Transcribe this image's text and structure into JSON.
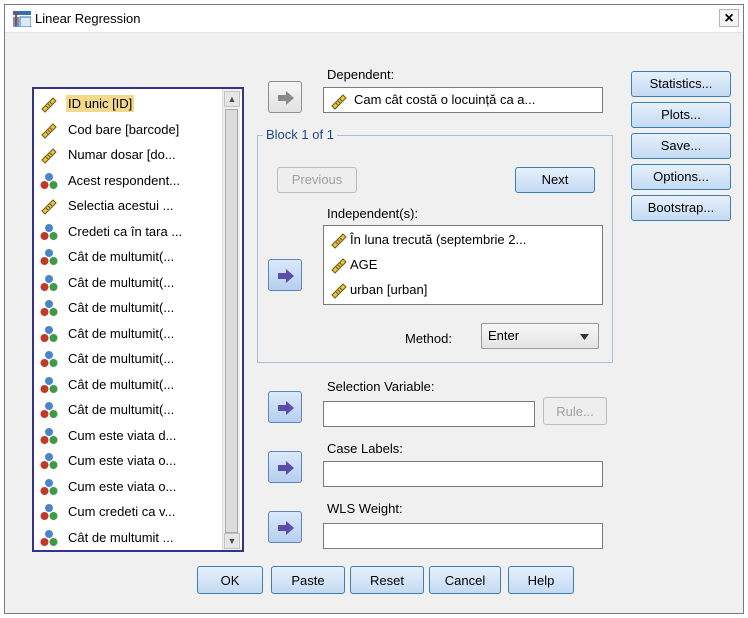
{
  "window": {
    "title": "Linear Regression",
    "close_label": "×"
  },
  "variables": [
    {
      "label": "ID unic [ID]",
      "type": "scale",
      "selected": true
    },
    {
      "label": "Cod bare [barcode]",
      "type": "scale"
    },
    {
      "label": "Numar dosar [do...",
      "type": "scale"
    },
    {
      "label": "Acest respondent...",
      "type": "nominal"
    },
    {
      "label": "Selectia acestui ...",
      "type": "scale"
    },
    {
      "label": "Credeti ca în tara ...",
      "type": "nominal"
    },
    {
      "label": "Cât de multumit(...",
      "type": "nominal"
    },
    {
      "label": "Cât de multumit(...",
      "type": "nominal"
    },
    {
      "label": "Cât de multumit(...",
      "type": "nominal"
    },
    {
      "label": "Cât de multumit(...",
      "type": "nominal"
    },
    {
      "label": "Cât de multumit(...",
      "type": "nominal"
    },
    {
      "label": "Cât de multumit(...",
      "type": "nominal"
    },
    {
      "label": "Cât de multumit(...",
      "type": "nominal"
    },
    {
      "label": "Cum este viata d...",
      "type": "nominal"
    },
    {
      "label": "Cum este viata o...",
      "type": "nominal"
    },
    {
      "label": "Cum este viata o...",
      "type": "nominal"
    },
    {
      "label": "Cum credeti ca v...",
      "type": "nominal"
    },
    {
      "label": "Cât de multumit ...",
      "type": "nominal"
    }
  ],
  "dependent": {
    "label": "Dependent:",
    "value": "Cam cât costă o locuință ca a..."
  },
  "block": {
    "legend": "Block 1 of 1",
    "previous_label": "Previous",
    "next_label": "Next"
  },
  "independents": {
    "label": "Independent(s):",
    "items": [
      {
        "label": "În luna trecută (septembrie 2..."
      },
      {
        "label": "AGE"
      },
      {
        "label": "urban [urban]"
      }
    ]
  },
  "method": {
    "label": "Method:",
    "value": "Enter"
  },
  "selection": {
    "label": "Selection Variable:",
    "value": "",
    "rule_label": "Rule..."
  },
  "case_labels": {
    "label": "Case Labels:",
    "value": ""
  },
  "wls": {
    "label": "WLS Weight:",
    "value": ""
  },
  "side_buttons": [
    "Statistics...",
    "Plots...",
    "Save...",
    "Options...",
    "Bootstrap..."
  ],
  "bottom_buttons": [
    "OK",
    "Paste",
    "Reset",
    "Cancel",
    "Help"
  ],
  "colors": {
    "selection": "#f3d98c",
    "list_border": "#33338a",
    "group_title": "#1e4a87"
  }
}
